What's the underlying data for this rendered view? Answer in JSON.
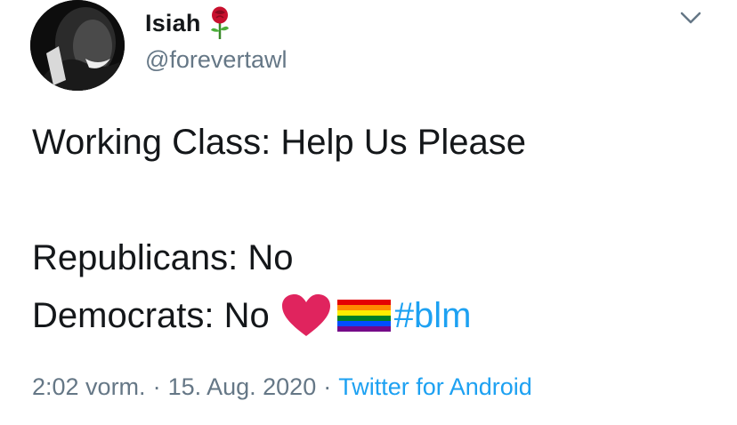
{
  "author": {
    "name": "Isiah",
    "handle": "@forevertawl",
    "name_emoji": "rose-icon",
    "avatar": "profile-photo"
  },
  "tweet": {
    "line1": "Working Class: Help Us Please",
    "line2": "Republicans: No",
    "line3_prefix": "Democrats: No",
    "line3_emojis": [
      "heart-icon",
      "rainbow-flag-icon"
    ],
    "hashtag": "#blm"
  },
  "meta": {
    "time": "2:02 vorm.",
    "separator": "·",
    "date": "15. Aug. 2020",
    "source": "Twitter for Android"
  },
  "colors": {
    "text": "#14171a",
    "secondary": "#657786",
    "link": "#1da1f2",
    "heart": "#e0245e"
  },
  "menu": {
    "icon": "chevron-down-icon"
  }
}
